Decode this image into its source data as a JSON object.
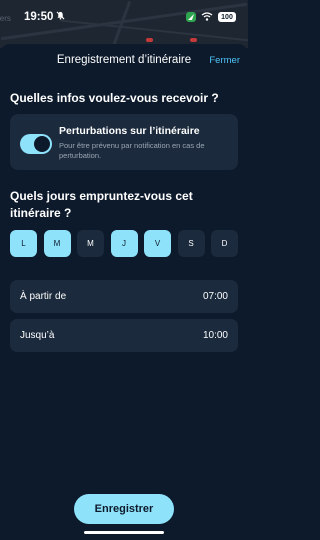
{
  "status_bar": {
    "time": "19:50",
    "battery": "100"
  },
  "map_background": {
    "visible_word": "iers"
  },
  "header": {
    "title": "Enregistrement d’itinéraire",
    "close_label": "Fermer"
  },
  "info_section": {
    "question": "Quelles infos voulez-vous recevoir ?",
    "notification": {
      "title": "Perturbations sur l’itinéraire",
      "description": "Pour être prévenu par notification en cas de perturbation.",
      "enabled": true
    }
  },
  "days_section": {
    "question": "Quels jours empruntez-vous cet itinéraire ?",
    "days": [
      {
        "label": "L",
        "selected": true
      },
      {
        "label": "M",
        "selected": true
      },
      {
        "label": "M",
        "selected": false
      },
      {
        "label": "J",
        "selected": true
      },
      {
        "label": "V",
        "selected": true
      },
      {
        "label": "S",
        "selected": false
      },
      {
        "label": "D",
        "selected": false
      }
    ]
  },
  "time_range": {
    "from": {
      "label": "À partir de",
      "value": "07:00"
    },
    "to": {
      "label": "Jusqu’à",
      "value": "10:00"
    }
  },
  "save_button": {
    "label": "Enregistrer"
  },
  "colors": {
    "background": "#0d1a2b",
    "card": "#1b2a3c",
    "accent": "#8ee3fb",
    "link": "#4fc3f7"
  }
}
